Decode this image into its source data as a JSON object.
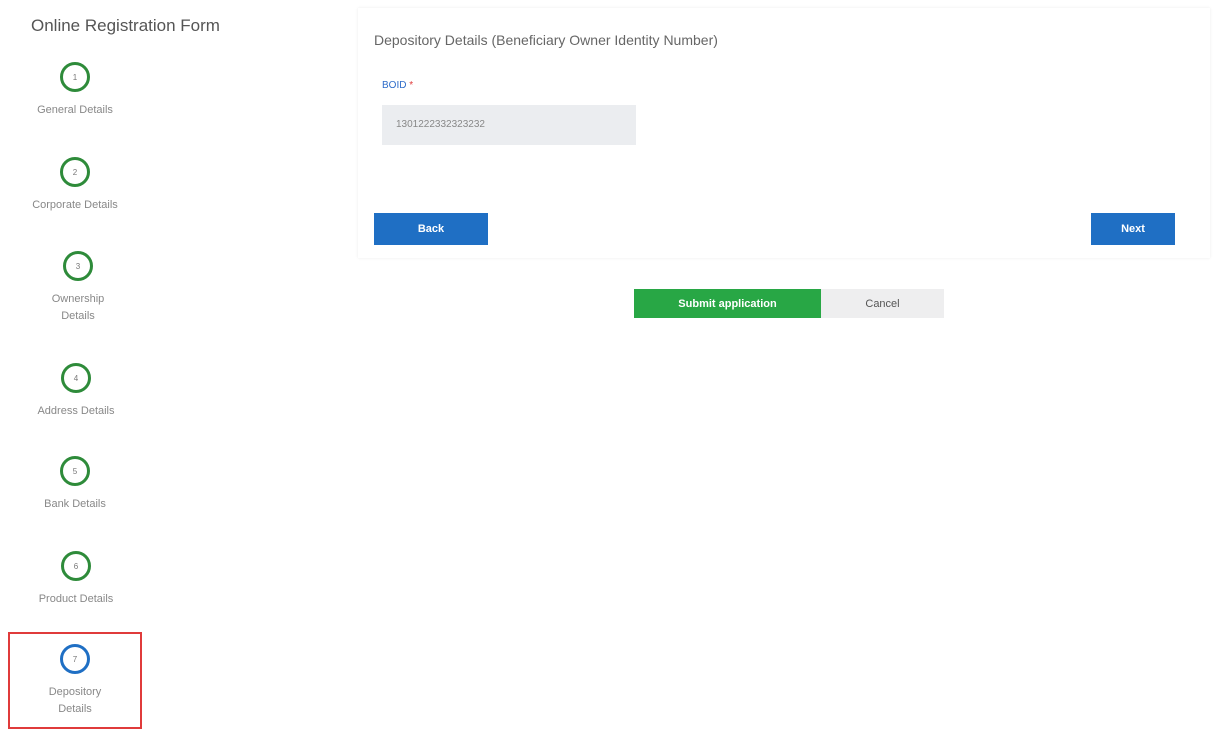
{
  "sidebar": {
    "title": "Online Registration Form",
    "steps": [
      {
        "number": "1",
        "label": "General Details"
      },
      {
        "number": "2",
        "label": "Corporate Details"
      },
      {
        "number": "3",
        "label": "Ownership Details"
      },
      {
        "number": "4",
        "label": "Address Details"
      },
      {
        "number": "5",
        "label": "Bank Details"
      },
      {
        "number": "6",
        "label": "Product Details"
      },
      {
        "number": "7",
        "label": "Depository Details"
      }
    ]
  },
  "main": {
    "title": "Depository Details (Beneficiary Owner Identity Number)",
    "boid_label": "BOID",
    "required_mark": "*",
    "boid_value": "1301222332323232",
    "back_label": "Back",
    "next_label": "Next"
  },
  "actions": {
    "submit_label": "Submit application",
    "cancel_label": "Cancel"
  },
  "colors": {
    "step_complete": "#2e8b3a",
    "step_active": "#1f6fc4",
    "primary": "#1f6fc4",
    "success": "#28a745",
    "highlight": "#e03b3b"
  }
}
